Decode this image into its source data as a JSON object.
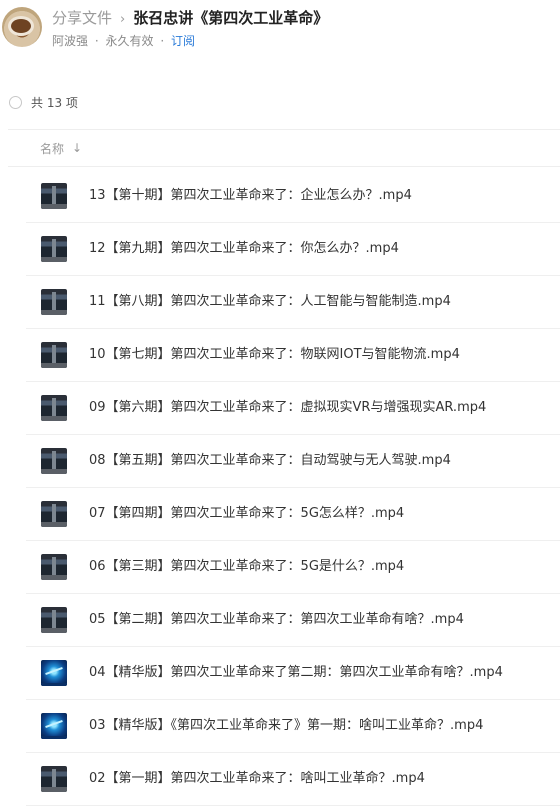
{
  "header": {
    "parent_label": "分享文件",
    "separator": "›",
    "title": "张召忠讲《第四次工业革命》",
    "owner": "阿波强",
    "dot1": "·",
    "validity": "永久有效",
    "dot2": "·",
    "subscribe_label": "订阅"
  },
  "summary": {
    "count_label": "共 13 项"
  },
  "columns": {
    "name_label": "名称",
    "sort_icon": "sort-down-arrow-icon"
  },
  "files": [
    {
      "name": "13【第十期】第四次工业革命来了：企业怎么办？.mp4",
      "thumb": "video-thumbnail"
    },
    {
      "name": "12【第九期】第四次工业革命来了：你怎么办？.mp4",
      "thumb": "video-thumbnail"
    },
    {
      "name": "11【第八期】第四次工业革命来了：人工智能与智能制造.mp4",
      "thumb": "video-thumbnail"
    },
    {
      "name": "10【第七期】第四次工业革命来了：物联网IOT与智能物流.mp4",
      "thumb": "video-thumbnail"
    },
    {
      "name": "09【第六期】第四次工业革命来了：虚拟现实VR与增强现实AR.mp4",
      "thumb": "video-thumbnail"
    },
    {
      "name": "08【第五期】第四次工业革命来了：自动驾驶与无人驾驶.mp4",
      "thumb": "video-thumbnail"
    },
    {
      "name": "07【第四期】第四次工业革命来了：5G怎么样？.mp4",
      "thumb": "video-thumbnail"
    },
    {
      "name": "06【第三期】第四次工业革命来了：5G是什么？.mp4",
      "thumb": "video-thumbnail"
    },
    {
      "name": "05【第二期】第四次工业革命来了：第四次工业革命有啥？.mp4",
      "thumb": "video-thumbnail"
    },
    {
      "name": "04【精华版】第四次工业革命来了第二期：第四次工业革命有啥？.mp4",
      "thumb": "video-thumbnail-blue"
    },
    {
      "name": "03【精华版】《第四次工业革命来了》第一期：啥叫工业革命？.mp4",
      "thumb": "video-thumbnail-blue"
    },
    {
      "name": "02【第一期】第四次工业革命来了：啥叫工业革命？.mp4",
      "thumb": "video-thumbnail"
    }
  ],
  "colors": {
    "accent": "#2a7bd8",
    "muted": "#9a9a9a",
    "text": "#333333"
  }
}
